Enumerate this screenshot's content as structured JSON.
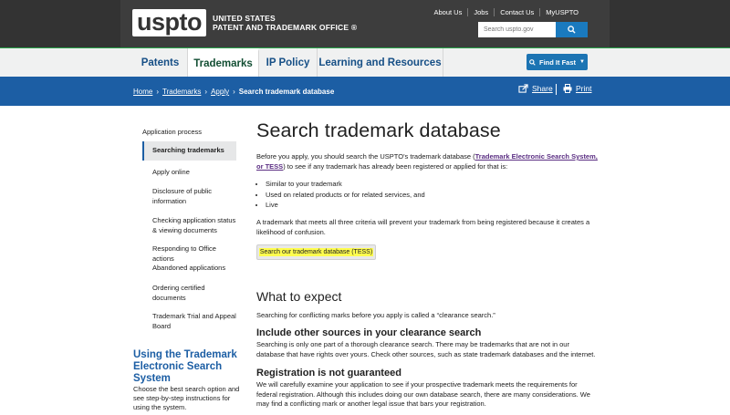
{
  "header": {
    "logo_mark": "uspto",
    "logo_line1": "UNITED STATES",
    "logo_line2": "PATENT AND TRADEMARK OFFICE ®",
    "utility_links": [
      "About Us",
      "Jobs",
      "Contact Us",
      "MyUSPTO"
    ],
    "search_placeholder": "Search uspto.gov",
    "search_icon": "search-icon"
  },
  "nav": {
    "items": [
      "Patents",
      "Trademarks",
      "IP Policy",
      "Learning and Resources"
    ],
    "active": "Trademarks",
    "find_it_fast": "Find It Fast"
  },
  "breadcrumb": {
    "items": [
      "Home",
      "Trademarks",
      "Apply"
    ],
    "current": "Search trademark database"
  },
  "tools": {
    "share": "Share",
    "print": "Print"
  },
  "sidebar": {
    "parent": "Application process",
    "items": [
      "Searching trademarks",
      "Apply online",
      "Disclosure of public information",
      "Checking application status & viewing documents",
      "Responding to Office actions",
      "Abandoned applications",
      "Ordering certified documents",
      "Trademark Trial and Appeal Board"
    ],
    "active_index": 0,
    "promo_title": "Using the Trademark Electronic Search System",
    "promo_text": "Choose the best search option and see step-by-step instructions for using the system."
  },
  "main": {
    "title": "Search trademark database",
    "intro_before": "Before you apply, you should search the USPTO's trademark database (",
    "intro_link": "Trademark Electronic Search System, or TESS",
    "intro_after": ") to see if any trademark has already been registered or applied for that is:",
    "bullets": [
      "Similar to your trademark",
      "Used on related products or for related services, and",
      "Live"
    ],
    "para2": "A trademark that meets all three criteria will prevent your trademark from being registered because it creates a likelihood of confusion.",
    "button": "Search our trademark database (TESS)",
    "expect_heading": "What to expect",
    "expect_text": "Searching for conflicting marks before you apply is called a “clearance search.”",
    "sub1_heading": "Include other sources in your clearance search",
    "sub1_text": "Searching is only one part of a thorough clearance search. There may be trademarks that are not in our database that have rights over yours. Check other sources, such as state trademark databases and the internet.",
    "sub2_heading": "Registration is not guaranteed",
    "sub2_text": "We will carefully examine your application to see if your prospective trademark meets the requirements for federal registration. Although this includes doing our own database search, there are many considerations. We may find a conflicting mark or another legal issue that bars your registration."
  },
  "colors": {
    "header_bg": "#3d3d3d",
    "nav_bg": "#f0f1f1",
    "nav_text": "#164f86",
    "blue_bar": "#1c5ea4",
    "accent_green": "#28a24a",
    "link_purple": "#5a2d82",
    "highlight": "#fffd4e"
  }
}
